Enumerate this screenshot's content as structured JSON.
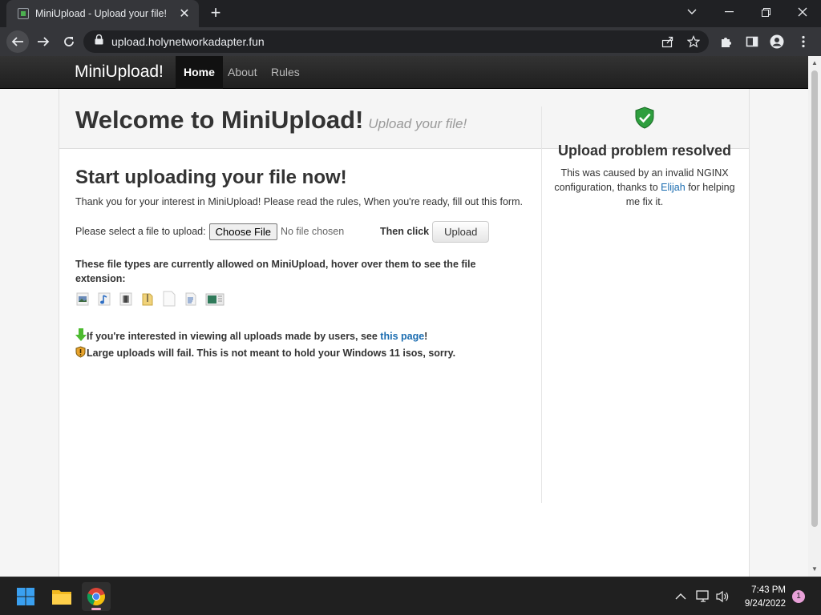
{
  "browser": {
    "tab_title": "MiniUpload - Upload your file!",
    "url": "upload.holynetworkadapter.fun"
  },
  "site": {
    "brand": "MiniUpload!",
    "nav": [
      "Home",
      "About",
      "Rules"
    ],
    "active_nav": "Home"
  },
  "hero": {
    "title": "Welcome to MiniUpload!",
    "subtitle": "Upload your file!"
  },
  "main": {
    "heading": "Start uploading your file now!",
    "intro": "Thank you for your interest in MiniUpload! Please read the rules, When you're ready, fill out this form.",
    "select_label": "Please select a file to upload:",
    "choose_file": "Choose File",
    "no_file": "No file chosen",
    "then_click": "Then click",
    "upload_button": "Upload",
    "types_text": "These file types are currently allowed on MiniUpload, hover over them to see the file extension:",
    "file_types": [
      "image-file-icon",
      "audio-file-icon",
      "video-file-icon",
      "archive-file-icon",
      "blank-file-icon",
      "text-file-icon",
      "spreadsheet-file-icon"
    ],
    "note1_prefix": "If you're interested in viewing all uploads made by users, see ",
    "note1_link": "this page",
    "note1_suffix": "!",
    "note2": "Large uploads will fail. This is not meant to hold your Windows 11 isos, sorry."
  },
  "sidebar": {
    "heading": "Upload problem resolved",
    "text_before": "This was caused by an invalid NGINX configuration, thanks to ",
    "link": "Elijah",
    "text_after": " for helping me fix it."
  },
  "taskbar": {
    "time": "7:43 PM",
    "date": "9/24/2022",
    "notifications": "1"
  },
  "colors": {
    "link": "#1a6cb0",
    "navbar": "#222222",
    "shield": "#2e9e3e"
  }
}
